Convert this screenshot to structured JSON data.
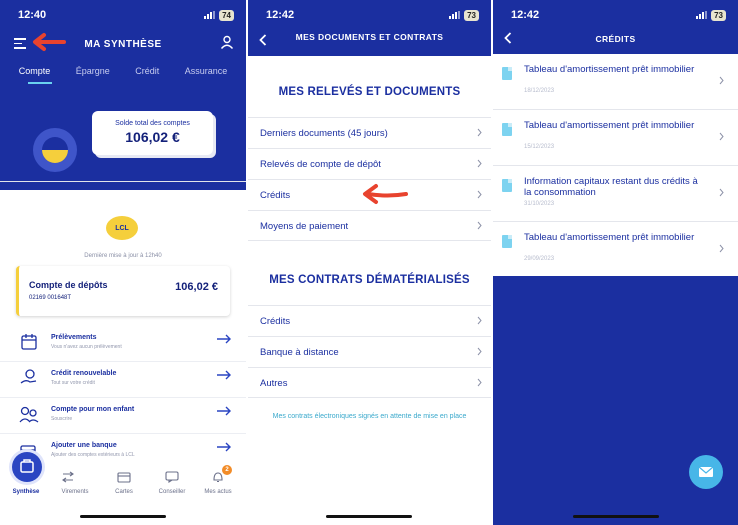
{
  "screen1": {
    "status": {
      "time": "12:40",
      "battery": "74"
    },
    "header_title": "MA SYNTHÈSE",
    "tabs": [
      "Compte",
      "Épargne",
      "Crédit",
      "Assurance"
    ],
    "active_tab": "Compte",
    "balance_label": "Solde total des comptes",
    "balance_amount": "106,02 €",
    "badge": "LCL",
    "last_update": "Dernière mise à jour à 12h40",
    "account": {
      "name": "Compte de dépôts",
      "number": "02169 001648T",
      "amount": "106,02 €"
    },
    "services": [
      {
        "title": "Prélèvements",
        "subtitle": "Vous n'avez aucun prélèvement"
      },
      {
        "title": "Crédit renouvelable",
        "subtitle": "Tout sur votre crédit"
      },
      {
        "title": "Compte pour mon enfant",
        "subtitle": "Souscrire"
      },
      {
        "title": "Ajouter une banque",
        "subtitle": "Ajouter des comptes extérieurs à LCL"
      }
    ],
    "bottom_nav": [
      "Synthèse",
      "Virements",
      "Cartes",
      "Conseiller",
      "Mes actus"
    ],
    "notification_count": "2",
    "colors": {
      "navy": "#1b2fa0",
      "yellow": "#f5cf3c",
      "annotation_red": "#e8432e"
    }
  },
  "screen2": {
    "status": {
      "time": "12:42",
      "battery": "73"
    },
    "header_title": "MES DOCUMENTS ET CONTRATS",
    "section1_title": "MES RELEVÉS ET DOCUMENTS",
    "section1_items": [
      "Derniers documents (45 jours)",
      "Relevés de compte de dépôt",
      "Crédits",
      "Moyens de paiement"
    ],
    "section2_title": "MES CONTRATS DÉMATÉRIALISÉS",
    "section2_items": [
      "Crédits",
      "Banque à distance",
      "Autres"
    ],
    "note": "Mes contrats électroniques signés en attente de mise en place"
  },
  "screen3": {
    "status": {
      "time": "12:42",
      "battery": "73"
    },
    "header_title": "CRÉDITS",
    "documents": [
      {
        "title": "Tableau d'amortissement prêt immobilier",
        "date": "18/12/2023"
      },
      {
        "title": "Tableau d'amortissement prêt immobilier",
        "date": "15/12/2023"
      },
      {
        "title": "Information capitaux restant dus crédits à la consommation",
        "date": "31/10/2023"
      },
      {
        "title": "Tableau d'amortissement prêt immobilier",
        "date": "29/09/2023"
      }
    ]
  }
}
